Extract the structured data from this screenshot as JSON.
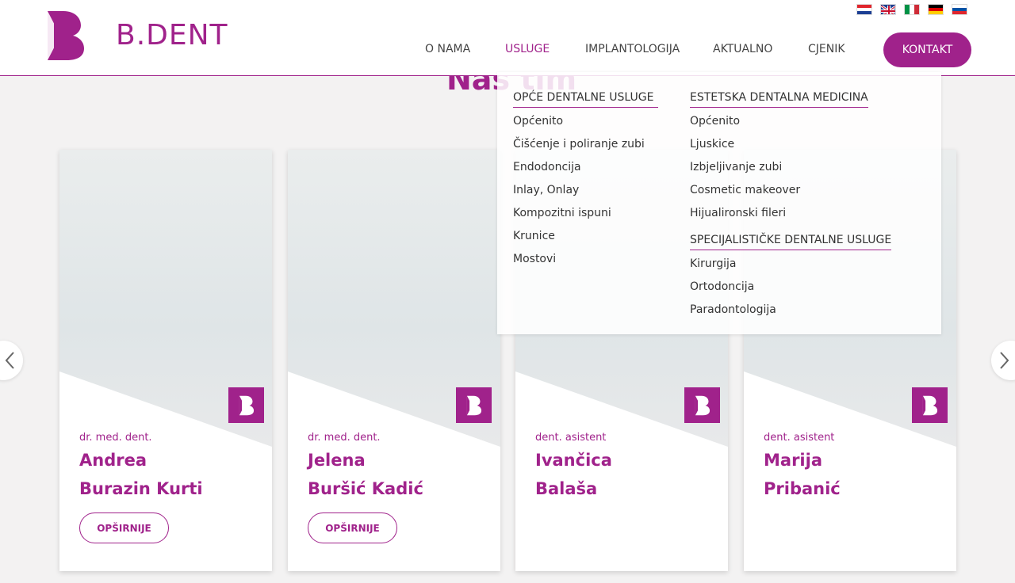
{
  "brand": {
    "name_prefix": "B",
    "dot": ".",
    "name_suffix": "DENT"
  },
  "languages": [
    "HR",
    "EN",
    "IT",
    "DE",
    "SI"
  ],
  "nav": {
    "items": [
      "O NAMA",
      "USLUGE",
      "IMPLANTOLOGIJA",
      "AKTUALNO",
      "CJENIK"
    ],
    "active": "USLUGE",
    "contact": "KONTAKT"
  },
  "section": {
    "title": "Naš tim"
  },
  "dropdown": {
    "col1": {
      "heading": "OPĆE DENTALNE USLUGE",
      "links": [
        "Općenito",
        "Čišćenje i poliranje zubi",
        "Endodoncija",
        "Inlay, Onlay",
        "Kompozitni ispuni",
        "Krunice",
        "Mostovi"
      ]
    },
    "col2": {
      "heading": "ESTETSKA DENTALNA MEDICINA",
      "links": [
        "Općenito",
        "Ljuskice",
        "Izbjeljivanje zubi",
        "Cosmetic makeover",
        "Hijualironski fileri"
      ]
    },
    "col3": {
      "heading": "SPECIJALISTIČKE DENTALNE USLUGE",
      "links": [
        "Kirurgija",
        "Ortodoncija",
        "Paradontologija"
      ]
    }
  },
  "team": [
    {
      "role": "dr. med. dent.",
      "first": "Andrea",
      "last": "Burazin Kurti",
      "button": "OPŠIRNIJE"
    },
    {
      "role": "dr. med. dent.",
      "first": "Jelena",
      "last": "Buršić Kadić",
      "button": "OPŠIRNIJE"
    },
    {
      "role": "dent. asistent",
      "first": "Ivančica",
      "last": "Balaša"
    },
    {
      "role": "dent. asistent",
      "first": "Marija",
      "last": "Pribanić"
    }
  ],
  "colors": {
    "accent": "#a0228b",
    "scrub": "#b726b8"
  },
  "icons": {
    "prev": "chevron-left-icon",
    "next": "chevron-right-icon",
    "badge": "bdent-logo-icon"
  }
}
